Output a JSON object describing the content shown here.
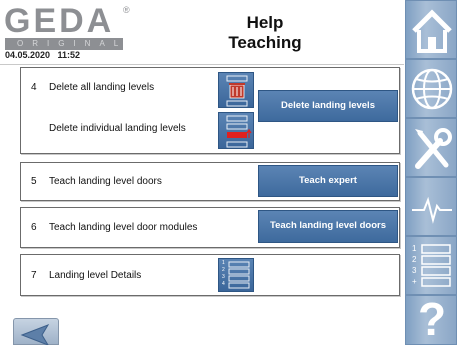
{
  "header": {
    "logo_text": "GEDA",
    "logo_registered": "®",
    "logo_subtitle": "ORIGINAL",
    "datetime": "04.05.2020   11:52",
    "title_line1": "Help",
    "title_line2": "Teaching"
  },
  "sections": [
    {
      "number": "4",
      "items": [
        {
          "label": "Delete all landing levels",
          "icon": "delete-all-landing-levels-icon"
        },
        {
          "label": "Delete individual landing levels",
          "icon": "delete-individual-landing-level-icon"
        }
      ],
      "button_label": "Delete landing levels"
    },
    {
      "number": "5",
      "label": "Teach landing level doors",
      "button_label": "Teach expert"
    },
    {
      "number": "6",
      "label": "Teach landing level door modules",
      "button_label": "Teach landing level doors"
    },
    {
      "number": "7",
      "label": "Landing level Details",
      "icon": "landing-level-list-icon",
      "icon_digits": [
        "1",
        "2",
        "3",
        "4"
      ]
    }
  ],
  "sidebar": [
    {
      "name": "home",
      "icon": "home-icon"
    },
    {
      "name": "language",
      "icon": "globe-icon"
    },
    {
      "name": "settings",
      "icon": "tools-icon"
    },
    {
      "name": "diagnostics",
      "icon": "waveform-icon"
    },
    {
      "name": "landing-level-list",
      "icon": "numbered-list-icon",
      "digits": [
        "1",
        "2",
        "3",
        "+"
      ]
    },
    {
      "name": "help",
      "icon": "help-icon",
      "glyph": "?"
    }
  ],
  "footer": {
    "back_icon": "back-arrow-icon"
  }
}
